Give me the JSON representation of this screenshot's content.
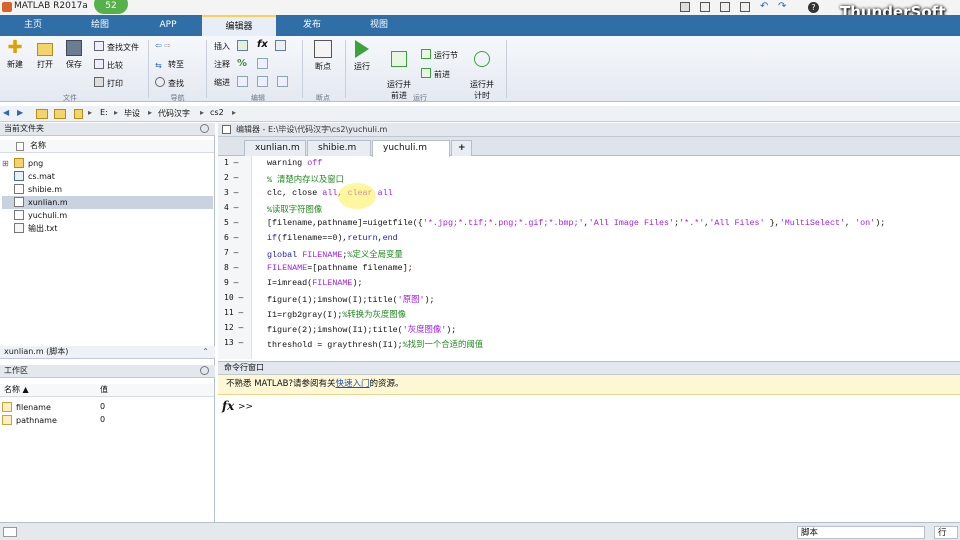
{
  "title_bar": {
    "app_title": "MATLAB R2017a",
    "badge": "52"
  },
  "brand": "ThunderSoft",
  "tabs": [
    "主页",
    "绘图",
    "APP",
    "编辑器",
    "发布",
    "视图"
  ],
  "ribbon": {
    "file": {
      "new": "新建",
      "open": "打开",
      "save": "保存",
      "find_files": "查找文件",
      "compare": "比较",
      "print": "打印",
      "group": "文件"
    },
    "navigate": {
      "goto": "转至",
      "find": "查找",
      "group": "导航"
    },
    "edit": {
      "insert": "插入",
      "comment": "注释",
      "indent": "缩进",
      "fx": "fx",
      "group": "编辑"
    },
    "breakpoints": {
      "label": "断点",
      "group": "断点"
    },
    "run": {
      "run": "运行",
      "run_advance": "运行并\n前进",
      "run_section": "运行节",
      "advance": "前进",
      "run_time": "运行并\n计时",
      "group": "运行"
    }
  },
  "address": {
    "segments": [
      "E:",
      "毕设",
      "代码汉字",
      "cs2"
    ]
  },
  "current_folder": {
    "title": "当前文件夹",
    "column_name": "名称",
    "items": [
      "png",
      "cs.mat",
      "shibie.m",
      "xunlian.m",
      "yuchuli.m",
      "输出.txt"
    ],
    "selected": "xunlian.m",
    "details": "xunlian.m  (脚本)"
  },
  "workspace": {
    "title": "工作区",
    "col_name": "名称 ▲",
    "col_value": "值",
    "vars": [
      {
        "name": "filename",
        "value": "0"
      },
      {
        "name": "pathname",
        "value": "0"
      }
    ]
  },
  "editor": {
    "header": "编辑器 - E:\\毕设\\代码汉字\\cs2\\yuchuli.m",
    "tabs": [
      "xunlian.m",
      "shibie.m",
      "yuchuli.m",
      "+"
    ],
    "active_tab": "yuchuli.m",
    "line_numbers": [
      "1",
      "2",
      "3",
      "4",
      "5",
      "6",
      "7",
      "8",
      "9",
      "10",
      "11",
      "12",
      "13"
    ],
    "lines": [
      "warning off",
      "% 清楚内存以及窗口",
      "clc, close all, clear all",
      "%读取字符图像",
      "[filename,pathname]=uigetfile({'*.jpg;*.tif;*.png;*.gif;*.bmp;','All Image Files';'*.*','All Files' },'MultiSelect', 'on');",
      "if(filename==0),return,end",
      "global FILENAME;%定义全局变量",
      "FILENAME=[pathname filename];",
      "I=imread(FILENAME);",
      "figure(1);imshow(I);title('原图');",
      "I1=rgb2gray(I);%转换为灰度图像",
      "figure(2);imshow(I1);title('灰度图像');",
      "threshold = graythresh(I1);%找到一个合适的阈值"
    ]
  },
  "command_window": {
    "title": "命令行窗口",
    "notice_prefix": "不熟悉 MATLAB?请参阅有关",
    "notice_link": "快速入门",
    "notice_suffix": "的资源。",
    "fx": "fx",
    "prompt": ">>"
  },
  "status_bar": {
    "script": "脚本",
    "row": "行"
  },
  "colors": {
    "tabbar": "#2f6ea6",
    "keyword": "#1c1cc4",
    "comment": "#1f8a1f",
    "string": "#a020f0"
  }
}
